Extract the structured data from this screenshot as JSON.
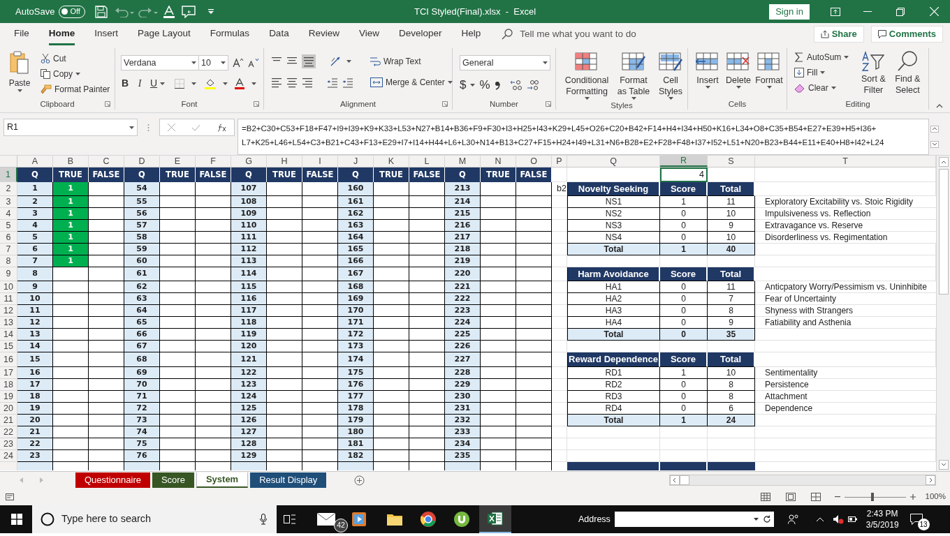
{
  "title_bar": {
    "autosave_label": "AutoSave",
    "autosave": {
      "on": false,
      "label": "Off"
    },
    "title": "TCI Styled(Final).xlsx  -  Excel",
    "sign_in": "Sign in"
  },
  "menu_tabs": [
    {
      "label": "File",
      "selected": false
    },
    {
      "label": "Home",
      "selected": true
    },
    {
      "label": "Insert",
      "selected": false
    },
    {
      "label": "Page Layout",
      "selected": false
    },
    {
      "label": "Formulas",
      "selected": false
    },
    {
      "label": "Data",
      "selected": false
    },
    {
      "label": "Review",
      "selected": false
    },
    {
      "label": "View",
      "selected": false
    },
    {
      "label": "Developer",
      "selected": false
    },
    {
      "label": "Help",
      "selected": false
    }
  ],
  "tell_me": "Tell me what you want to do",
  "share": "Share",
  "comments": "Comments",
  "ribbon": {
    "clipboard": {
      "paste": "Paste",
      "cut": "Cut",
      "copy": "Copy",
      "format_painter": "Format Painter",
      "label": "Clipboard"
    },
    "font": {
      "family": "Verdana",
      "size": "10",
      "bold": "B",
      "italic": "I",
      "underline": "U",
      "label": "Font"
    },
    "alignment": {
      "wrap_text": "Wrap Text",
      "merge_center": "Merge & Center",
      "label": "Alignment"
    },
    "number": {
      "format": "General",
      "currency": "$",
      "percent": "%",
      "label": "Number"
    },
    "styles": {
      "buttons": [
        "Conditional Formatting",
        "Format as Table",
        "Cell Styles"
      ],
      "label": "Styles"
    },
    "cells": {
      "buttons": [
        "Insert",
        "Delete",
        "Format"
      ],
      "label": "Cells"
    },
    "editing": {
      "autosum": "AutoSum",
      "fill": "Fill",
      "clear": "Clear",
      "sort": "Sort & Filter",
      "find": "Find & Select",
      "label": "Editing"
    }
  },
  "formula_bar": {
    "name_box": "R1",
    "formula_lines": [
      "=B2+C30+C53+F18+F47+I9+I39+K9+K33+L53+N27+B14+B36+F9+F30+I3+H25+I43+K29+L45+O26+C20+B42+F14+H4+I34+H50+K16+L34+O8+C35+B54+E27+E39+H5+I36+",
      "L7+K25+L46+L54+C3+B21+C43+F13+E29+I7+I14+H44+L6+L30+N14+B13+C27+F15+H24+I49+L31+N6+B28+E2+F28+F48+I37+I52+L51+N20+B23+B44+E11+E40+H8+I42+L24"
    ]
  },
  "sheet": {
    "column_headers": [
      {
        "label": "A",
        "selected": false
      },
      {
        "label": "B",
        "selected": false
      },
      {
        "label": "C",
        "selected": false
      },
      {
        "label": "D",
        "selected": false
      },
      {
        "label": "E",
        "selected": false
      },
      {
        "label": "F",
        "selected": false
      },
      {
        "label": "G",
        "selected": false
      },
      {
        "label": "H",
        "selected": false
      },
      {
        "label": "I",
        "selected": false
      },
      {
        "label": "J",
        "selected": false
      },
      {
        "label": "K",
        "selected": false
      },
      {
        "label": "L",
        "selected": false
      },
      {
        "label": "M",
        "selected": false
      },
      {
        "label": "N",
        "selected": false
      },
      {
        "label": "O",
        "selected": false
      },
      {
        "label": "P",
        "selected": false
      },
      {
        "label": "Q",
        "selected": false
      },
      {
        "label": "R",
        "selected": true
      },
      {
        "label": "S",
        "selected": false
      },
      {
        "label": "T",
        "selected": false
      }
    ],
    "row_numbers": [
      {
        "label": "1",
        "selected": true
      },
      {
        "label": "2",
        "selected": false
      },
      {
        "label": "3",
        "selected": false
      },
      {
        "label": "4",
        "selected": false
      },
      {
        "label": "5",
        "selected": false
      },
      {
        "label": "6",
        "selected": false
      },
      {
        "label": "7",
        "selected": false
      },
      {
        "label": "8",
        "selected": false
      },
      {
        "label": "9",
        "selected": false
      },
      {
        "label": "10",
        "selected": false
      },
      {
        "label": "11",
        "selected": false
      },
      {
        "label": "12",
        "selected": false
      },
      {
        "label": "13",
        "selected": false
      },
      {
        "label": "14",
        "selected": false
      },
      {
        "label": "15",
        "selected": false
      },
      {
        "label": "16",
        "selected": false
      },
      {
        "label": "17",
        "selected": false
      },
      {
        "label": "18",
        "selected": false
      },
      {
        "label": "19",
        "selected": false
      },
      {
        "label": "20",
        "selected": false
      },
      {
        "label": "21",
        "selected": false
      },
      {
        "label": "22",
        "selected": false
      },
      {
        "label": "23",
        "selected": false
      },
      {
        "label": "24",
        "selected": false
      }
    ],
    "active_cell_value": "4",
    "side_note": "b2",
    "question_blocks": [
      {
        "columns": [
          "Q",
          "TRUE",
          "FALSE"
        ],
        "rows": [
          {
            "q": "1",
            "true": "1"
          },
          {
            "q": "2",
            "true": "1"
          },
          {
            "q": "3",
            "true": "1"
          },
          {
            "q": "4",
            "true": "1"
          },
          {
            "q": "5",
            "true": "1"
          },
          {
            "q": "6",
            "true": "1"
          },
          {
            "q": "7",
            "true": "1"
          },
          {
            "q": "8"
          },
          {
            "q": "9"
          },
          {
            "q": "10"
          },
          {
            "q": "11"
          },
          {
            "q": "12"
          },
          {
            "q": "13"
          },
          {
            "q": "14"
          },
          {
            "q": "15"
          },
          {
            "q": "16"
          },
          {
            "q": "17"
          },
          {
            "q": "18"
          },
          {
            "q": "19"
          },
          {
            "q": "20"
          },
          {
            "q": "21"
          },
          {
            "q": "22"
          },
          {
            "q": "23"
          }
        ]
      },
      {
        "columns": [
          "Q",
          "TRUE",
          "FALSE"
        ],
        "rows": [
          {
            "q": "54"
          },
          {
            "q": "55"
          },
          {
            "q": "56"
          },
          {
            "q": "57"
          },
          {
            "q": "58"
          },
          {
            "q": "59"
          },
          {
            "q": "60"
          },
          {
            "q": "61"
          },
          {
            "q": "62"
          },
          {
            "q": "63"
          },
          {
            "q": "64"
          },
          {
            "q": "65"
          },
          {
            "q": "66"
          },
          {
            "q": "67"
          },
          {
            "q": "68"
          },
          {
            "q": "69"
          },
          {
            "q": "70"
          },
          {
            "q": "71"
          },
          {
            "q": "72"
          },
          {
            "q": "73"
          },
          {
            "q": "74"
          },
          {
            "q": "75"
          },
          {
            "q": "76"
          }
        ]
      },
      {
        "columns": [
          "Q",
          "TRUE",
          "FALSE"
        ],
        "rows": [
          {
            "q": "107"
          },
          {
            "q": "108"
          },
          {
            "q": "109"
          },
          {
            "q": "110"
          },
          {
            "q": "111"
          },
          {
            "q": "112"
          },
          {
            "q": "113"
          },
          {
            "q": "114"
          },
          {
            "q": "115"
          },
          {
            "q": "116"
          },
          {
            "q": "117"
          },
          {
            "q": "118"
          },
          {
            "q": "119"
          },
          {
            "q": "120"
          },
          {
            "q": "121"
          },
          {
            "q": "122"
          },
          {
            "q": "123"
          },
          {
            "q": "124"
          },
          {
            "q": "125"
          },
          {
            "q": "126"
          },
          {
            "q": "127"
          },
          {
            "q": "128"
          },
          {
            "q": "129"
          }
        ]
      },
      {
        "columns": [
          "Q",
          "TRUE",
          "FALSE"
        ],
        "rows": [
          {
            "q": "160"
          },
          {
            "q": "161"
          },
          {
            "q": "162"
          },
          {
            "q": "163"
          },
          {
            "q": "164"
          },
          {
            "q": "165"
          },
          {
            "q": "166"
          },
          {
            "q": "167"
          },
          {
            "q": "168"
          },
          {
            "q": "169"
          },
          {
            "q": "170"
          },
          {
            "q": "171"
          },
          {
            "q": "172"
          },
          {
            "q": "173"
          },
          {
            "q": "174"
          },
          {
            "q": "175"
          },
          {
            "q": "176"
          },
          {
            "q": "177"
          },
          {
            "q": "178"
          },
          {
            "q": "179"
          },
          {
            "q": "180"
          },
          {
            "q": "181"
          },
          {
            "q": "182"
          }
        ]
      },
      {
        "columns": [
          "Q",
          "TRUE",
          "FALSE"
        ],
        "rows": [
          {
            "q": "213"
          },
          {
            "q": "214"
          },
          {
            "q": "215"
          },
          {
            "q": "216"
          },
          {
            "q": "217"
          },
          {
            "q": "218"
          },
          {
            "q": "219"
          },
          {
            "q": "220"
          },
          {
            "q": "221"
          },
          {
            "q": "222"
          },
          {
            "q": "223"
          },
          {
            "q": "224"
          },
          {
            "q": "225"
          },
          {
            "q": "226"
          },
          {
            "q": "227"
          },
          {
            "q": "228"
          },
          {
            "q": "229"
          },
          {
            "q": "230"
          },
          {
            "q": "231"
          },
          {
            "q": "232"
          },
          {
            "q": "233"
          },
          {
            "q": "234"
          },
          {
            "q": "235"
          }
        ]
      }
    ],
    "score_tables": [
      {
        "columns": [
          "Novelty Seeking",
          "Score",
          "Total"
        ],
        "rows": [
          {
            "cells": [
              "NS1",
              "1",
              "11"
            ],
            "description": "Exploratory Excitability vs. Stoic Rigidity"
          },
          {
            "cells": [
              "NS2",
              "0",
              "10"
            ],
            "description": "Impulsiveness vs. Reflection"
          },
          {
            "cells": [
              "NS3",
              "0",
              "9"
            ],
            "description": "Extravagance vs. Reserve"
          },
          {
            "cells": [
              "NS4",
              "0",
              "10"
            ],
            "description": "Disorderliness vs. Regimentation"
          }
        ],
        "total": [
          "Total",
          "1",
          "40"
        ]
      },
      {
        "columns": [
          "Harm Avoidance",
          "Score",
          "Total"
        ],
        "rows": [
          {
            "cells": [
              "HA1",
              "0",
              "11"
            ],
            "description": "Anticpatory Worry/Pessimism vs. Uninhibite"
          },
          {
            "cells": [
              "HA2",
              "0",
              "7"
            ],
            "description": "Fear of Uncertainty"
          },
          {
            "cells": [
              "HA3",
              "0",
              "8"
            ],
            "description": "Shyness with Strangers"
          },
          {
            "cells": [
              "HA4",
              "0",
              "9"
            ],
            "description": "Fatiability and Asthenia"
          }
        ],
        "total": [
          "Total",
          "0",
          "35"
        ]
      },
      {
        "columns": [
          "Reward Dependence",
          "Score",
          "Total"
        ],
        "rows": [
          {
            "cells": [
              "RD1",
              "1",
              "10"
            ],
            "description": "Sentimentality"
          },
          {
            "cells": [
              "RD2",
              "0",
              "8"
            ],
            "description": "Persistence"
          },
          {
            "cells": [
              "RD3",
              "0",
              "8"
            ],
            "description": "Attachment"
          },
          {
            "cells": [
              "RD4",
              "0",
              "6"
            ],
            "description": "Dependence"
          }
        ],
        "total": [
          "Total",
          "1",
          "24"
        ]
      }
    ]
  },
  "sheet_tabs": [
    {
      "label": "Questionnaire",
      "color": "#c00000",
      "selected": false
    },
    {
      "label": "Score",
      "color": "#375623",
      "selected": false
    },
    {
      "label": "System",
      "color": "#375623",
      "selected": true
    },
    {
      "label": "Result Display",
      "color": "#1f4e79",
      "selected": false
    }
  ],
  "status_bar": {
    "zoom": {
      "level": 0.46,
      "reading": "100%"
    }
  },
  "taskbar": {
    "search_placeholder": "Type here to search",
    "mail_badge": "42",
    "address_label": "Address",
    "time": "2:43 PM",
    "date": "3/5/2019",
    "notifications": "13"
  }
}
